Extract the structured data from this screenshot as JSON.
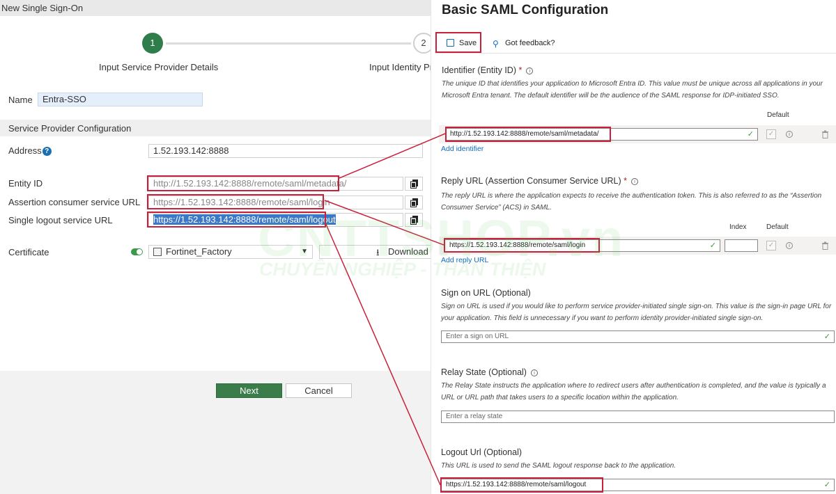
{
  "wizard": {
    "window_title": "New Single Sign-On",
    "steps": [
      {
        "number": "1",
        "label": "Input Service Provider Details"
      },
      {
        "number": "2",
        "label": "Input Identity Pro"
      }
    ],
    "name_label": "Name",
    "name_value": "Entra-SSO",
    "section_title": "Service Provider Configuration",
    "address_label": "Address",
    "address_value": "1.52.193.142:8888",
    "entity_id_label": "Entity ID",
    "entity_id_value": "http://1.52.193.142:8888/remote/saml/metadata/",
    "acs_label": "Assertion consumer service URL",
    "acs_value": "https://1.52.193.142:8888/remote/saml/login",
    "slo_label": "Single logout service URL",
    "slo_value": "https://1.52.193.142:8888/remote/saml/logout",
    "certificate_label": "Certificate",
    "certificate_value": "Fortinet_Factory",
    "download_label": "Download",
    "next_label": "Next",
    "cancel_label": "Cancel",
    "colors": {
      "step_active": "#2f7d4a",
      "next_button": "#3a7d4b",
      "annotation": "#c8203a"
    }
  },
  "entra": {
    "title": "Basic SAML Configuration",
    "save_label": "Save",
    "feedback_label": "Got feedback?",
    "identifier": {
      "heading": "Identifier (Entity ID)",
      "required_mark": "*",
      "description": "The unique ID that identifies your application to Microsoft Entra ID. This value must be unique across all applications in your Microsoft Entra tenant. The default identifier will be the audience of the SAML response for IDP-initiated SSO.",
      "default_header": "Default",
      "value": "http://1.52.193.142:8888/remote/saml/metadata/",
      "add_link": "Add identifier"
    },
    "reply": {
      "heading": "Reply URL (Assertion Consumer Service URL)",
      "required_mark": "*",
      "description": "The reply URL is where the application expects to receive the authentication token. This is also referred to as the “Assertion Consumer Service” (ACS) in SAML.",
      "index_header": "Index",
      "default_header": "Default",
      "value": "https://1.52.193.142:8888/remote/saml/login",
      "add_link": "Add reply URL"
    },
    "signon": {
      "heading": "Sign on URL (Optional)",
      "description": "Sign on URL is used if you would like to perform service provider-initiated single sign-on. This value is the sign-in page URL for your application. This field is unnecessary if you want to perform identity provider-initiated single sign-on.",
      "placeholder": "Enter a sign on URL"
    },
    "relay": {
      "heading": "Relay State (Optional)",
      "description": "The Relay State instructs the application where to redirect users after authentication is completed, and the value is typically a URL or URL path that takes users to a specific location within the application.",
      "placeholder": "Enter a relay state"
    },
    "logout": {
      "heading": "Logout Url (Optional)",
      "description": "This URL is used to send the SAML logout response back to the application.",
      "value": "https://1.52.193.142:8888/remote/saml/logout"
    }
  }
}
